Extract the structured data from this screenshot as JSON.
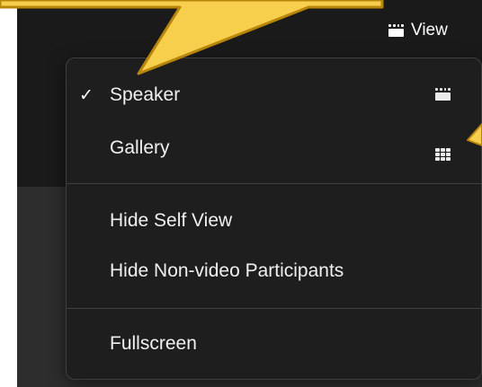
{
  "toolbar": {
    "view_label": "View",
    "view_icon": "speaker-view-icon"
  },
  "menu": {
    "items": [
      {
        "label": "Speaker",
        "checked": true,
        "icon": "speaker-view-icon",
        "checkmark": "✓"
      },
      {
        "label": "Gallery",
        "checked": false,
        "icon": "gallery-view-icon"
      },
      {
        "label": "Hide Self View"
      },
      {
        "label": "Hide Non-video Participants"
      },
      {
        "label": "Fullscreen"
      }
    ]
  },
  "colors": {
    "callout_fill": "#f8cf4c",
    "callout_stroke": "#b8860b",
    "menu_bg": "#1e1e1e",
    "app_dark": "#1a1a1a",
    "app_mid": "#2d2d2d"
  }
}
